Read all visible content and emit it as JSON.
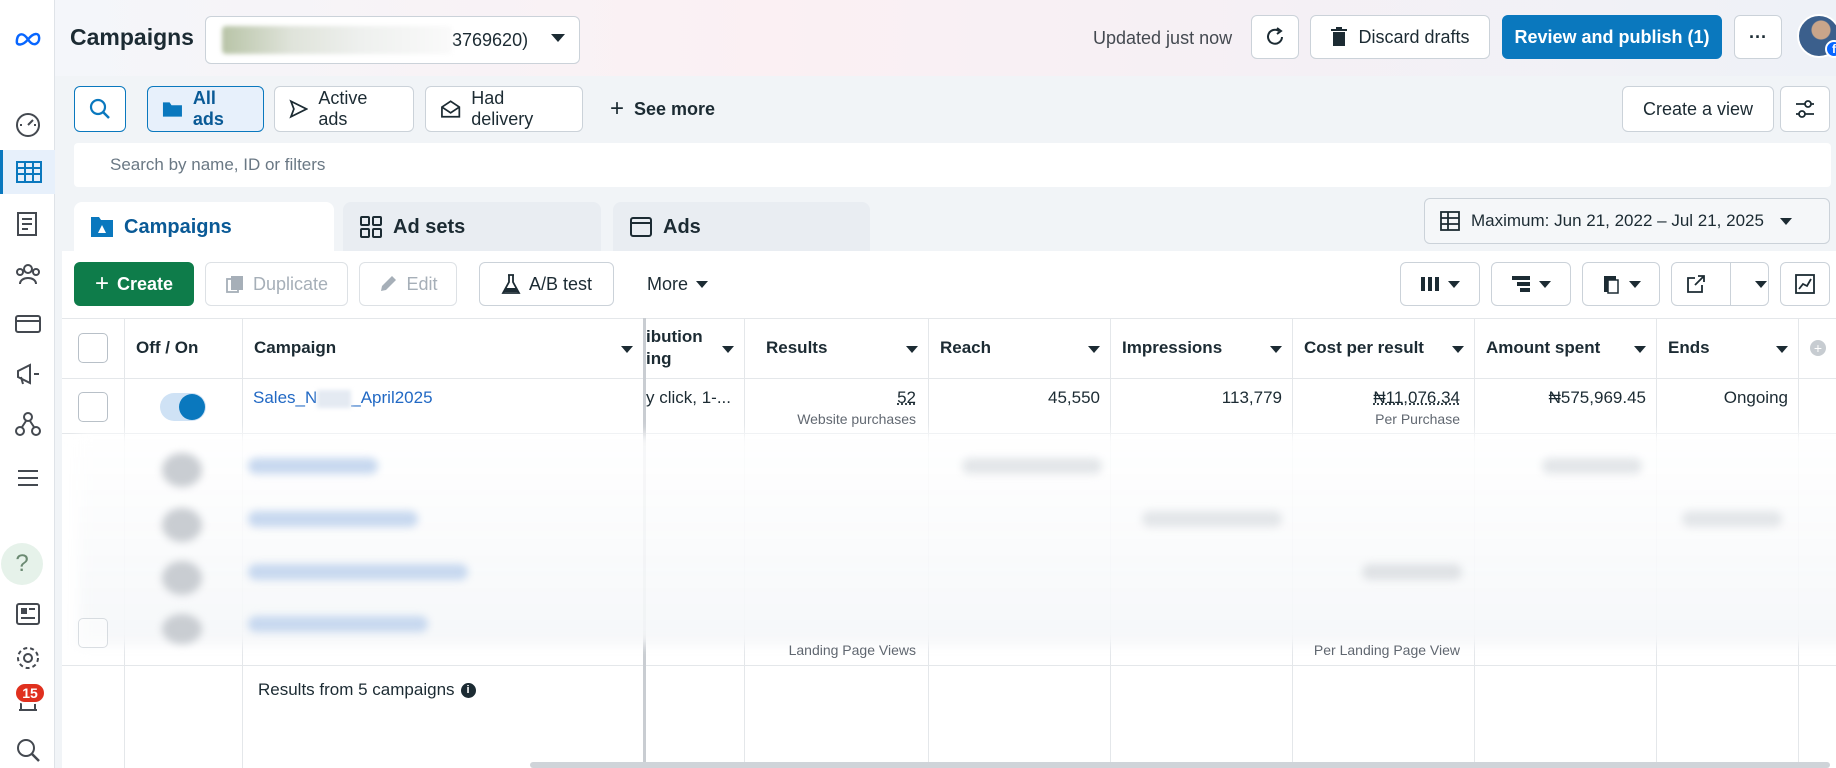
{
  "header": {
    "title": "Campaigns",
    "account_id_suffix": "3769620)",
    "updated": "Updated just now",
    "discard": "Discard drafts",
    "publish": "Review and publish (1)",
    "more": "···"
  },
  "filters": {
    "all_ads": "All ads",
    "active_ads": "Active ads",
    "had_delivery": "Had delivery",
    "see_more": "See more",
    "create_view": "Create a view",
    "search_placeholder": "Search by name, ID or filters"
  },
  "tabs": {
    "campaigns": "Campaigns",
    "ad_sets": "Ad sets",
    "ads": "Ads"
  },
  "date_range": "Maximum: Jun 21, 2022 – Jul 21, 2025",
  "toolbar": {
    "create": "Create",
    "duplicate": "Duplicate",
    "edit": "Edit",
    "ab_test": "A/B test",
    "more": "More"
  },
  "table": {
    "columns": {
      "off_on": "Off / On",
      "campaign": "Campaign",
      "attribution": "ibution\ning",
      "results": "Results",
      "reach": "Reach",
      "impressions": "Impressions",
      "cost_per_result": "Cost per result",
      "amount_spent": "Amount spent",
      "ends": "Ends"
    },
    "row1": {
      "campaign_a": "Sales_N",
      "campaign_b": "_April2025",
      "attribution": "y click, 1-...",
      "results": "52",
      "results_sub": "Website purchases",
      "reach": "45,550",
      "impressions": "113,779",
      "cost": "₦11,076.34",
      "cost_sub": "Per Purchase",
      "spent": "₦575,969.45",
      "ends": "Ongoing"
    },
    "row5": {
      "results_sub": "Landing Page Views",
      "cost_sub": "Per Landing Page View"
    },
    "summary": "Results from 5 campaigns"
  },
  "notifications": {
    "count": "15"
  },
  "help": "?",
  "colors": {
    "primary": "#0a78be",
    "create": "#0e7c4a",
    "badge": "#e0301e"
  }
}
